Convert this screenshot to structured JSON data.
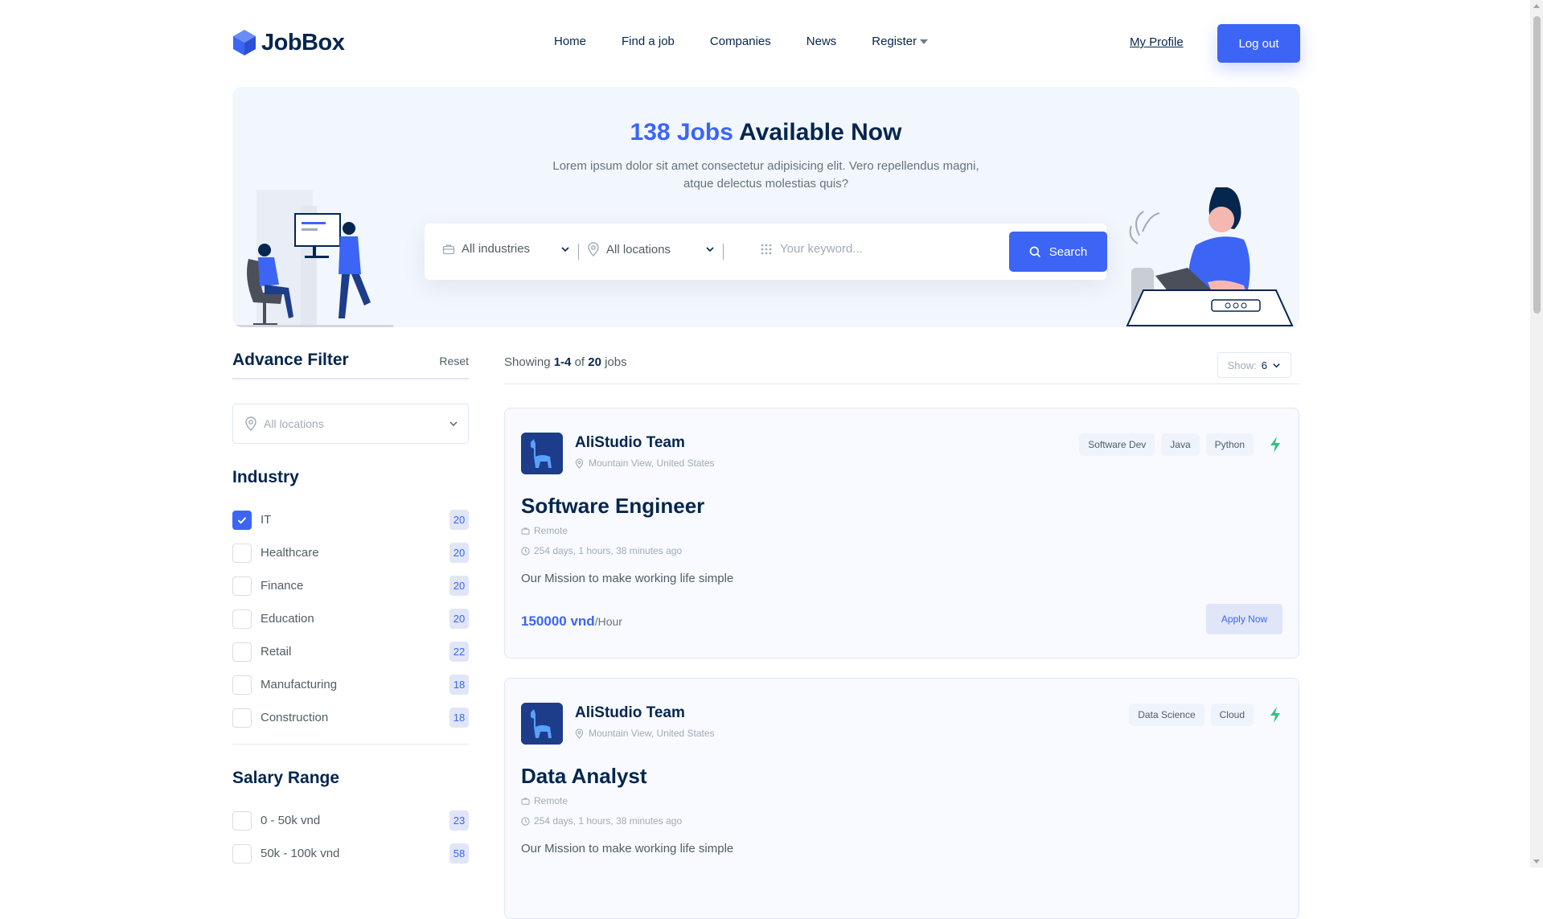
{
  "header": {
    "logo_text": "JobBox",
    "nav": [
      {
        "label": "Home"
      },
      {
        "label": "Find a job"
      },
      {
        "label": "Companies"
      },
      {
        "label": "News"
      },
      {
        "label": "Register"
      }
    ],
    "my_profile": "My Profile",
    "logout": "Log out"
  },
  "hero": {
    "title_highlight": "138 Jobs",
    "title_rest": " Available Now",
    "subtitle": "Lorem ipsum dolor sit amet consectetur adipisicing elit. Vero repellendus magni, atque delectus molestias quis?",
    "industry_select": "All industries",
    "location_select": "All locations",
    "keyword_placeholder": "Your keyword...",
    "search_button": "Search"
  },
  "filter": {
    "title": "Advance Filter",
    "reset": "Reset",
    "location_select": "All locations",
    "industry_title": "Industry",
    "industries": [
      {
        "label": "IT",
        "count": "20",
        "checked": true
      },
      {
        "label": "Healthcare",
        "count": "20",
        "checked": false
      },
      {
        "label": "Finance",
        "count": "20",
        "checked": false
      },
      {
        "label": "Education",
        "count": "20",
        "checked": false
      },
      {
        "label": "Retail",
        "count": "22",
        "checked": false
      },
      {
        "label": "Manufacturing",
        "count": "18",
        "checked": false
      },
      {
        "label": "Construction",
        "count": "18",
        "checked": false
      }
    ],
    "salary_title": "Salary Range",
    "salaries": [
      {
        "label": "0 - 50k vnd",
        "count": "23",
        "checked": false
      },
      {
        "label": "50k - 100k vnd",
        "count": "58",
        "checked": false
      }
    ]
  },
  "results": {
    "showing_prefix": "Showing ",
    "showing_range": "1-4",
    "showing_of": " of ",
    "showing_total": "20",
    "showing_suffix": " jobs",
    "show_label": "Show:",
    "show_value": "6"
  },
  "jobs": [
    {
      "company": "AliStudio Team",
      "location": "Mountain View, United States",
      "tags": [
        "Software Dev",
        "Java",
        "Python"
      ],
      "title": "Software Engineer",
      "type": "Remote",
      "time": "254 days, 1 hours, 38 minutes ago",
      "description": "Our Mission to make working life simple",
      "salary": "150000 vnd",
      "salary_unit": "/Hour",
      "apply": "Apply Now"
    },
    {
      "company": "AliStudio Team",
      "location": "Mountain View, United States",
      "tags": [
        "Data Science",
        "Cloud"
      ],
      "title": "Data Analyst",
      "type": "Remote",
      "time": "254 days, 1 hours, 38 minutes ago",
      "description": "Our Mission to make working life simple"
    }
  ],
  "colors": {
    "primary": "#3c65f5",
    "heading": "#05264e",
    "hero_bg": "#f2f6fd",
    "badge_bg": "#e0e6f7",
    "bolt": "#2ec37b"
  }
}
